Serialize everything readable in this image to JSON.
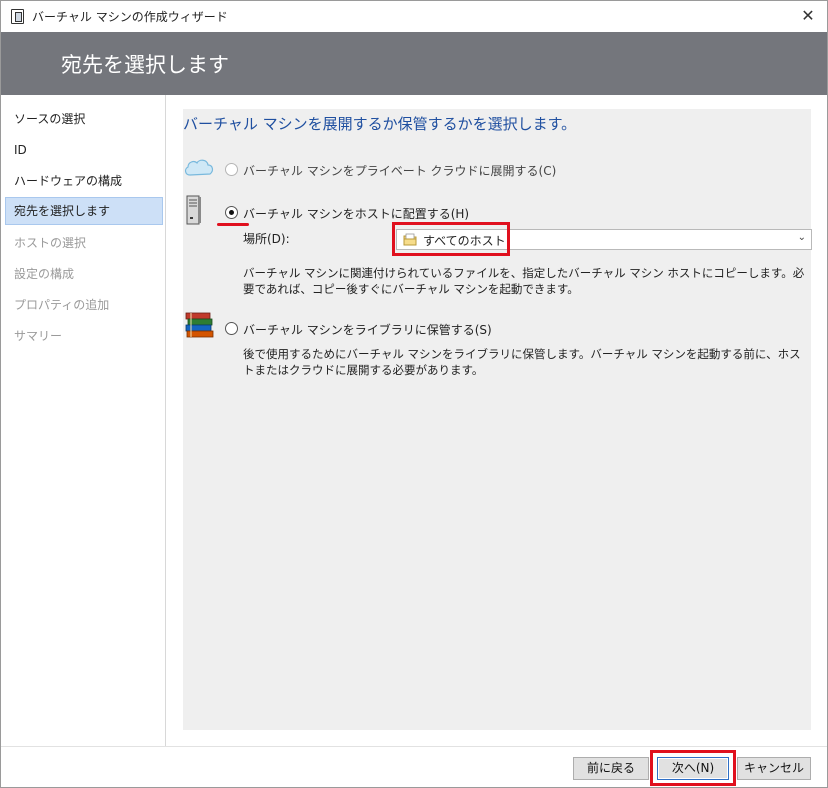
{
  "window": {
    "title": "バーチャル マシンの作成ウィザード",
    "close_label": "✕"
  },
  "header": {
    "title": "宛先を選択します"
  },
  "nav": {
    "items": [
      {
        "label": "ソースの選択",
        "state": "normal"
      },
      {
        "label": "ID",
        "state": "normal"
      },
      {
        "label": "ハードウェアの構成",
        "state": "normal"
      },
      {
        "label": "宛先を選択します",
        "state": "selected"
      },
      {
        "label": "ホストの選択",
        "state": "disabled"
      },
      {
        "label": "設定の構成",
        "state": "disabled"
      },
      {
        "label": "プロパティの追加",
        "state": "disabled"
      },
      {
        "label": "サマリー",
        "state": "disabled"
      }
    ]
  },
  "main": {
    "heading": "バーチャル マシンを展開するか保管するかを選択します。",
    "options": {
      "cloud": {
        "label": "バーチャル マシンをプライベート クラウドに展開する(C)",
        "icon": "cloud-icon",
        "checked": false,
        "enabled": false
      },
      "host": {
        "label": "バーチャル マシンをホストに配置する(H)",
        "icon": "server-icon",
        "checked": true,
        "enabled": true
      },
      "library": {
        "label": "バーチャル マシンをライブラリに保管する(S)",
        "icon": "books-icon",
        "checked": false,
        "enabled": true
      }
    },
    "location": {
      "label": "場所(D):",
      "value": "すべてのホスト",
      "icon": "folder-icon"
    },
    "host_description": "バーチャル マシンに関連付けられているファイルを、指定したバーチャル マシン ホストにコピーします。必要であれば、コピー後すぐにバーチャル マシンを起動できます。",
    "library_description": "後で使用するためにバーチャル マシンをライブラリに保管します。バーチャル マシンを起動する前に、ホストまたはクラウドに展開する必要があります。"
  },
  "footer": {
    "back_label": "前に戻る",
    "next_label": "次へ(N)",
    "cancel_label": "キャンセル"
  },
  "colors": {
    "header_bg": "#74767c",
    "heading_text": "#1f4fa0",
    "highlight_red": "#e0101e",
    "selected_nav": "#cde0f7"
  }
}
